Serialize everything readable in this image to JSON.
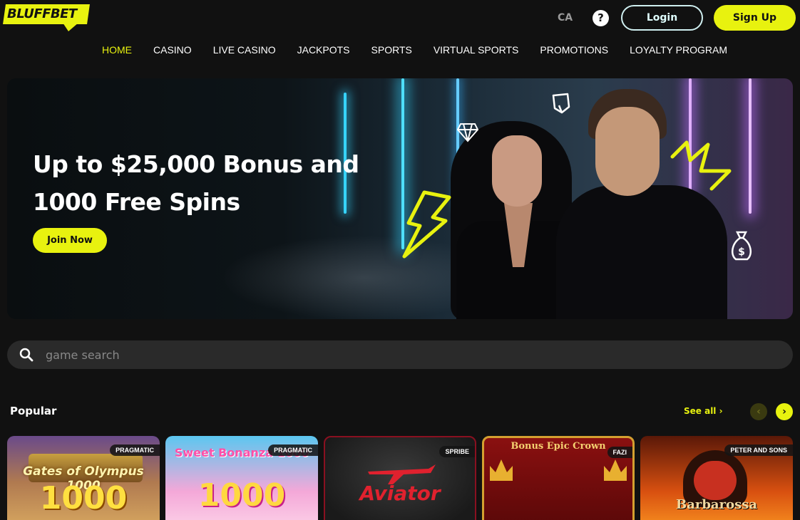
{
  "header": {
    "logo_text": "BLUFFBET",
    "region": "CA",
    "help_label": "?",
    "login_label": "Login",
    "signup_label": "Sign Up"
  },
  "nav": [
    {
      "label": "HOME",
      "active": true
    },
    {
      "label": "CASINO"
    },
    {
      "label": "LIVE CASINO"
    },
    {
      "label": "JACKPOTS"
    },
    {
      "label": "SPORTS"
    },
    {
      "label": "VIRTUAL SPORTS"
    },
    {
      "label": "PROMOTIONS"
    },
    {
      "label": "LOYALTY PROGRAM"
    }
  ],
  "hero": {
    "title_line1": "Up to $25,000 Bonus and",
    "title_line2": "1000 Free Spins",
    "cta_label": "Join Now"
  },
  "search": {
    "placeholder": "game search"
  },
  "popular": {
    "title": "Popular",
    "see_all": "See all ›",
    "prev_icon": "chevron-left-icon",
    "next_icon": "chevron-right-icon",
    "games": [
      {
        "provider": "PRAGMATIC",
        "title": "Gates of Olympus 1000"
      },
      {
        "provider": "PRAGMATIC",
        "title": "Sweet Bonanza 1000"
      },
      {
        "provider": "SPRIBE",
        "title": "Aviator"
      },
      {
        "provider": "FAZI",
        "title": "Bonus Epic Crown"
      },
      {
        "provider": "PETER AND SONS",
        "title": "Barbarossa"
      }
    ]
  },
  "colors": {
    "accent": "#e8f20f",
    "background": "#111111",
    "search_bg": "#2a2a2a"
  }
}
